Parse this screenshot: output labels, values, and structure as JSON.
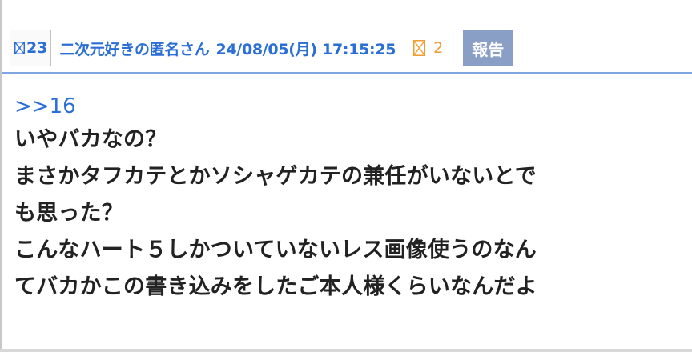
{
  "post": {
    "res_number": "23",
    "poster_name": "二次元好きの匿名さん",
    "timestamp": "24/08/05(月) 17:15:25",
    "reply_count": "2",
    "report_label": "報告",
    "anchor": ">>16",
    "lines": [
      "いやバカなの？",
      "まさかタフカテとかソシャゲカテの兼任がいないとで",
      "も思った？",
      "こんなハート５しかついていないレス画像使うのなん",
      "てバカかこの書き込みをしたご本人様くらいなんだよ"
    ]
  },
  "colors": {
    "link_blue": "#2b6fd6",
    "reply_orange": "#f29a2e",
    "report_bg": "#8a9fc6",
    "divider": "#7ea6e0"
  },
  "icons": {
    "res_number_icon": "boxed-x-icon",
    "reply_icon": "boxed-x-icon"
  }
}
